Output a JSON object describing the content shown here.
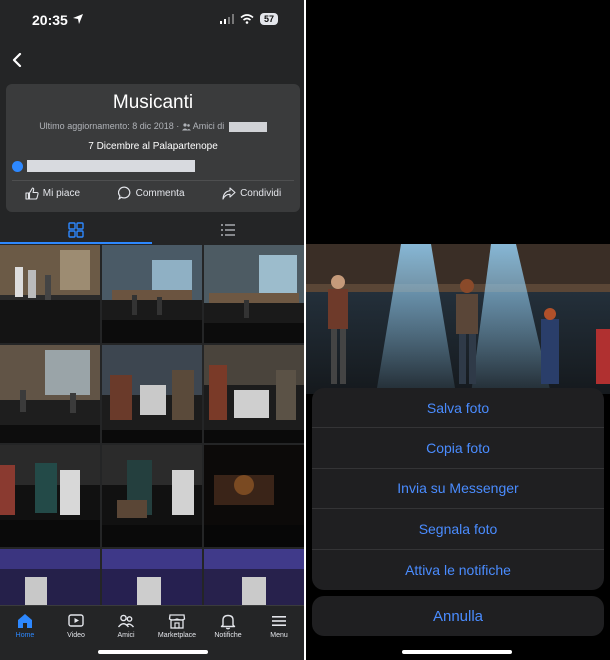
{
  "status": {
    "time": "20:35",
    "battery": "57"
  },
  "album": {
    "title": "Musicanti",
    "meta_updated": "Ultimo aggiornamento: 8 dic 2018 · ",
    "meta_audience": "Amici di",
    "description": "7 Dicembre al Palapartenope"
  },
  "actions": {
    "like": "Mi piace",
    "comment": "Commenta",
    "share": "Condividi"
  },
  "nav": [
    {
      "label": "Home",
      "icon": "home-icon"
    },
    {
      "label": "Video",
      "icon": "video-icon"
    },
    {
      "label": "Amici",
      "icon": "friends-icon"
    },
    {
      "label": "Marketplace",
      "icon": "marketplace-icon"
    },
    {
      "label": "Notifiche",
      "icon": "bell-icon"
    },
    {
      "label": "Menu",
      "icon": "menu-icon"
    }
  ],
  "sheet": {
    "items": [
      "Salva foto",
      "Copia foto",
      "Invia su Messenger",
      "Segnala foto",
      "Attiva le notifiche"
    ],
    "cancel": "Annulla"
  },
  "colors": {
    "accent": "#2d88ff",
    "sheet_text": "#4a8cff",
    "background": "#242526"
  }
}
